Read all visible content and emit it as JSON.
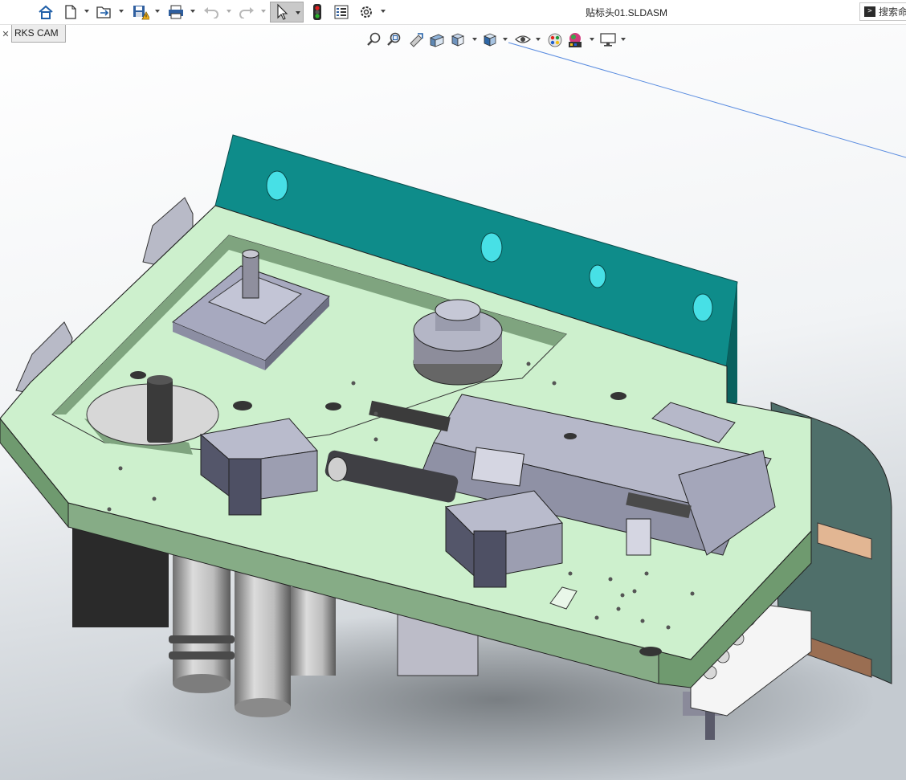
{
  "window": {
    "document_title": "贴标头01.SLDASM"
  },
  "search": {
    "label": "搜索命",
    "icon": "terminal-icon"
  },
  "tabs": {
    "cam_tab_label": "RKS CAM"
  },
  "toolbar": {
    "icons": [
      "home-icon",
      "new-document-icon",
      "open-icon",
      "save-icon",
      "print-icon",
      "undo-icon",
      "redo-icon",
      "select-arrow-icon",
      "traffic-light-icon",
      "file-properties-icon",
      "options-gear-icon"
    ]
  },
  "heads_up_view": {
    "icons": [
      "zoom-to-fit-icon",
      "zoom-to-area-icon",
      "previous-view-icon",
      "section-view-icon",
      "view-orientation-icon",
      "display-style-icon",
      "hide-show-items-icon",
      "edit-appearance-icon",
      "apply-scene-icon",
      "view-settings-icon"
    ]
  },
  "colors": {
    "plate": "#cdf0cd",
    "plate_side": "#6f9a6f",
    "wall": "#0e8c8a",
    "part_steel": "#a7a9bf",
    "background_top": "#ffffff",
    "background_bottom": "#bfc6cd"
  }
}
